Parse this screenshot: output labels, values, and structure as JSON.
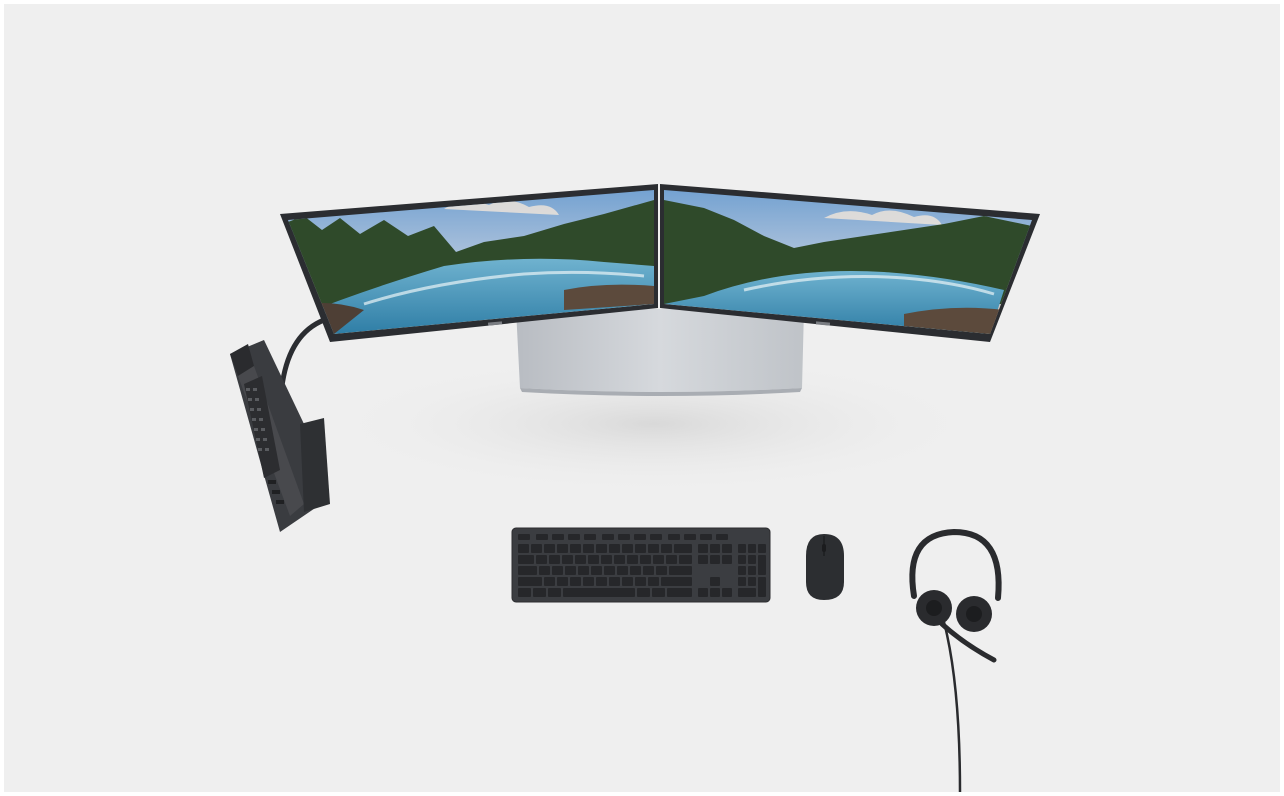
{
  "scene": {
    "background_color": "#efefef",
    "frame_color": "#ffffff",
    "objects": [
      "dual-curved-monitors",
      "monitor-stand",
      "mini-pc-tower",
      "video-cable",
      "wireless-keyboard",
      "wireless-mouse",
      "usb-headset"
    ],
    "monitor_screen_image": "forest-river-landscape",
    "colors": {
      "device_dark": "#3a3c40",
      "stand_silver": "#c9ccd1",
      "sky_blue": "#8fb4d9",
      "water_blue": "#3f8fb3",
      "forest_green": "#2f4a2a"
    }
  }
}
